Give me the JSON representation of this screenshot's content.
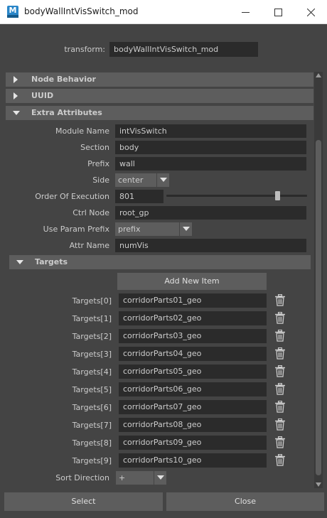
{
  "window": {
    "title": "bodyWallIntVisSwitch_mod",
    "app_icon_letter": "M"
  },
  "transform": {
    "label": "transform:",
    "value": "bodyWallIntVisSwitch_mod"
  },
  "sections": {
    "node_behavior": "Node Behavior",
    "uuid": "UUID",
    "extra_attributes": "Extra Attributes",
    "targets": "Targets"
  },
  "attributes": {
    "module_name": {
      "label": "Module Name",
      "value": "intVisSwitch"
    },
    "section": {
      "label": "Section",
      "value": "body"
    },
    "prefix": {
      "label": "Prefix",
      "value": "wall"
    },
    "side": {
      "label": "Side",
      "value": "center"
    },
    "order_of_execution": {
      "label": "Order Of Execution",
      "value": "801",
      "slider_fraction": 0.79
    },
    "ctrl_node": {
      "label": "Ctrl Node",
      "value": "root_gp"
    },
    "use_param_prefix": {
      "label": "Use Param Prefix",
      "value": "prefix"
    },
    "attr_name": {
      "label": "Attr Name",
      "value": "numVis"
    }
  },
  "targets": {
    "add_button": "Add New Item",
    "items": [
      {
        "label": "Targets[0]",
        "value": "corridorParts01_geo"
      },
      {
        "label": "Targets[1]",
        "value": "corridorParts02_geo"
      },
      {
        "label": "Targets[2]",
        "value": "corridorParts03_geo"
      },
      {
        "label": "Targets[3]",
        "value": "corridorParts04_geo"
      },
      {
        "label": "Targets[4]",
        "value": "corridorParts05_geo"
      },
      {
        "label": "Targets[5]",
        "value": "corridorParts06_geo"
      },
      {
        "label": "Targets[6]",
        "value": "corridorParts07_geo"
      },
      {
        "label": "Targets[7]",
        "value": "corridorParts08_geo"
      },
      {
        "label": "Targets[8]",
        "value": "corridorParts09_geo"
      },
      {
        "label": "Targets[9]",
        "value": "corridorParts10_geo"
      }
    ],
    "sort_direction": {
      "label": "Sort Direction",
      "value": "+"
    }
  },
  "buttons": {
    "select": "Select",
    "close": "Close"
  },
  "colors": {
    "background": "#444444",
    "field": "#2b2b2b",
    "header": "#5d5d5d",
    "text": "#cccccc",
    "icon_blue": "#2a86c8"
  }
}
